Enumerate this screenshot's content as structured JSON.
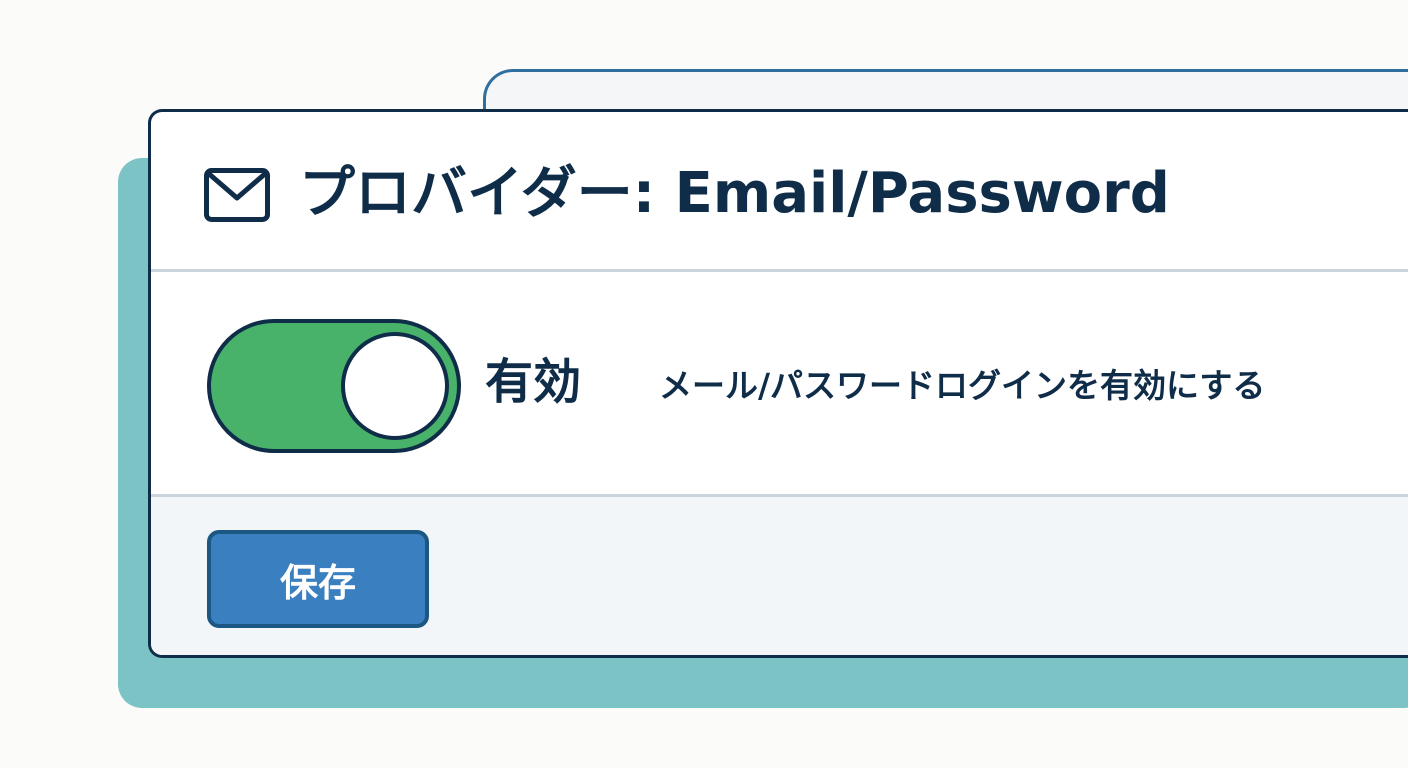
{
  "provider": {
    "title": "プロバイダー: Email/Password",
    "icon": "mail-icon"
  },
  "toggle": {
    "enabled": true,
    "state_label": "有効",
    "description": "メール/パスワードログインを有効にする"
  },
  "footer": {
    "save_label": "保存"
  },
  "colors": {
    "accent_teal": "#7cc3c6",
    "toggle_on": "#48b26a",
    "primary_button": "#3a7fbf",
    "text_dark": "#0f2d48",
    "tab_outline": "#2f6f9f"
  }
}
